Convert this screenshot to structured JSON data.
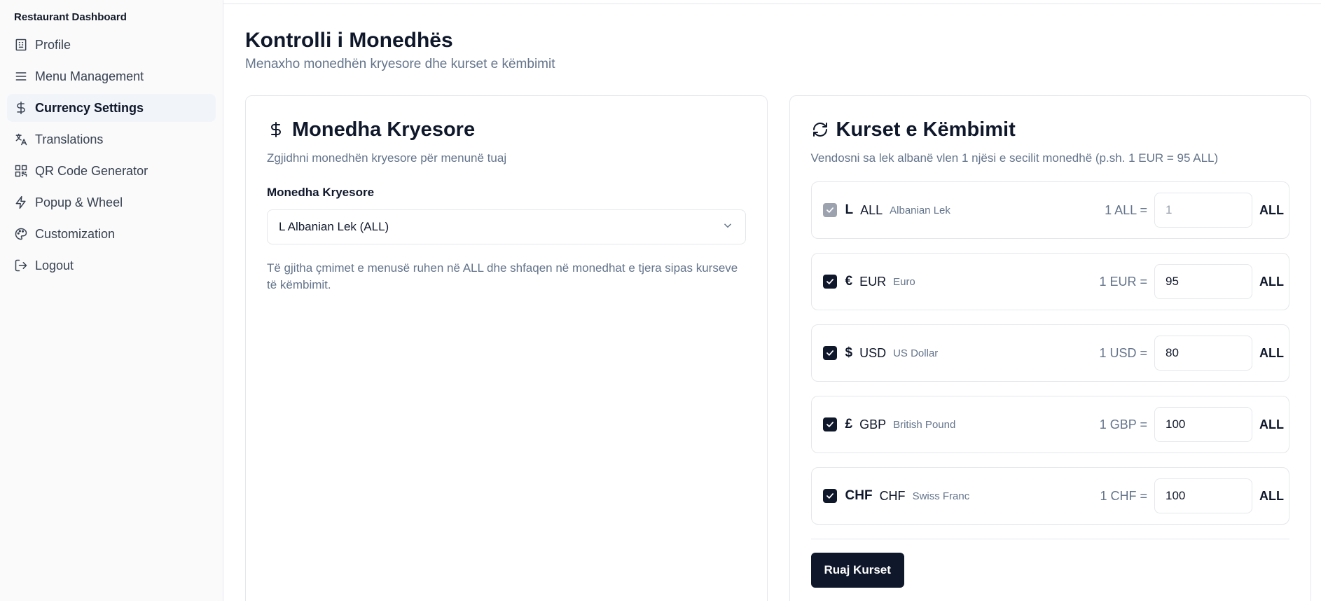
{
  "sidebar": {
    "brand": "Restaurant Dashboard",
    "items": [
      {
        "label": "Profile",
        "icon": "building-icon"
      },
      {
        "label": "Menu Management",
        "icon": "menu-icon"
      },
      {
        "label": "Currency Settings",
        "icon": "dollar-icon",
        "active": true
      },
      {
        "label": "Translations",
        "icon": "languages-icon"
      },
      {
        "label": "QR Code Generator",
        "icon": "qr-code-icon"
      },
      {
        "label": "Popup & Wheel",
        "icon": "zap-icon"
      },
      {
        "label": "Customization",
        "icon": "palette-icon"
      },
      {
        "label": "Logout",
        "icon": "logout-icon"
      }
    ]
  },
  "header": {
    "title": "Kontrolli i Monedhës",
    "subtitle": "Menaxho monedhën kryesore dhe kurset e këmbimit"
  },
  "primary": {
    "title": "Monedha Kryesore",
    "description": "Zgjidhni monedhën kryesore për menunë tuaj",
    "field_label": "Monedha Kryesore",
    "selected": "L Albanian Lek (ALL)",
    "hint": "Të gjitha çmimet e menusë ruhen në ALL dhe shfaqen në monedhat e tjera sipas kurseve të këmbimit."
  },
  "rates": {
    "title": "Kurset e Këmbimit",
    "description": "Vendosni sa lek albanë vlen 1 njësi e secilit monedhë (p.sh. 1 EUR = 95 ALL)",
    "unit": "ALL",
    "save_label": "Ruaj Kurset",
    "rows": [
      {
        "symbol": "L",
        "code": "ALL",
        "name": "Albanian Lek",
        "eq": "1 ALL =",
        "value": "1",
        "checked": true,
        "disabled": true
      },
      {
        "symbol": "€",
        "code": "EUR",
        "name": "Euro",
        "eq": "1 EUR =",
        "value": "95",
        "checked": true,
        "disabled": false
      },
      {
        "symbol": "$",
        "code": "USD",
        "name": "US Dollar",
        "eq": "1 USD =",
        "value": "80",
        "checked": true,
        "disabled": false
      },
      {
        "symbol": "£",
        "code": "GBP",
        "name": "British Pound",
        "eq": "1 GBP =",
        "value": "100",
        "checked": true,
        "disabled": false
      },
      {
        "symbol": "CHF",
        "code": "CHF",
        "name": "Swiss Franc",
        "eq": "1 CHF =",
        "value": "100",
        "checked": true,
        "disabled": false
      }
    ]
  },
  "colors": {
    "primary": "#0f172a",
    "muted": "#64748b",
    "border": "#e5e7eb",
    "active_bg": "#f1f5f9"
  }
}
